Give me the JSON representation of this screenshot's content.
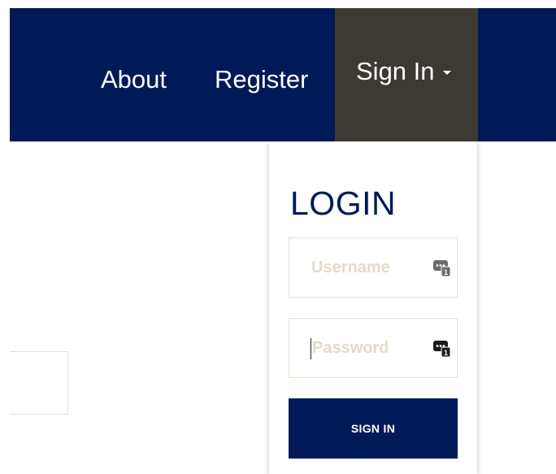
{
  "nav": {
    "about_label": "About",
    "register_label": "Register",
    "signin_label": "Sign In"
  },
  "login": {
    "title": "LOGIN",
    "username_placeholder": "Username",
    "password_placeholder": "Password",
    "submit_label": "SIGN IN"
  },
  "icons": {
    "username_field_icon": "password-manager-key-icon",
    "password_field_icon": "password-manager-key-icon"
  },
  "colors": {
    "navbar_bg": "#001a57",
    "signin_tab_bg": "#3c3a32",
    "accent": "#001a57",
    "field_border": "#e6dfd0",
    "placeholder": "#e2dacb"
  }
}
